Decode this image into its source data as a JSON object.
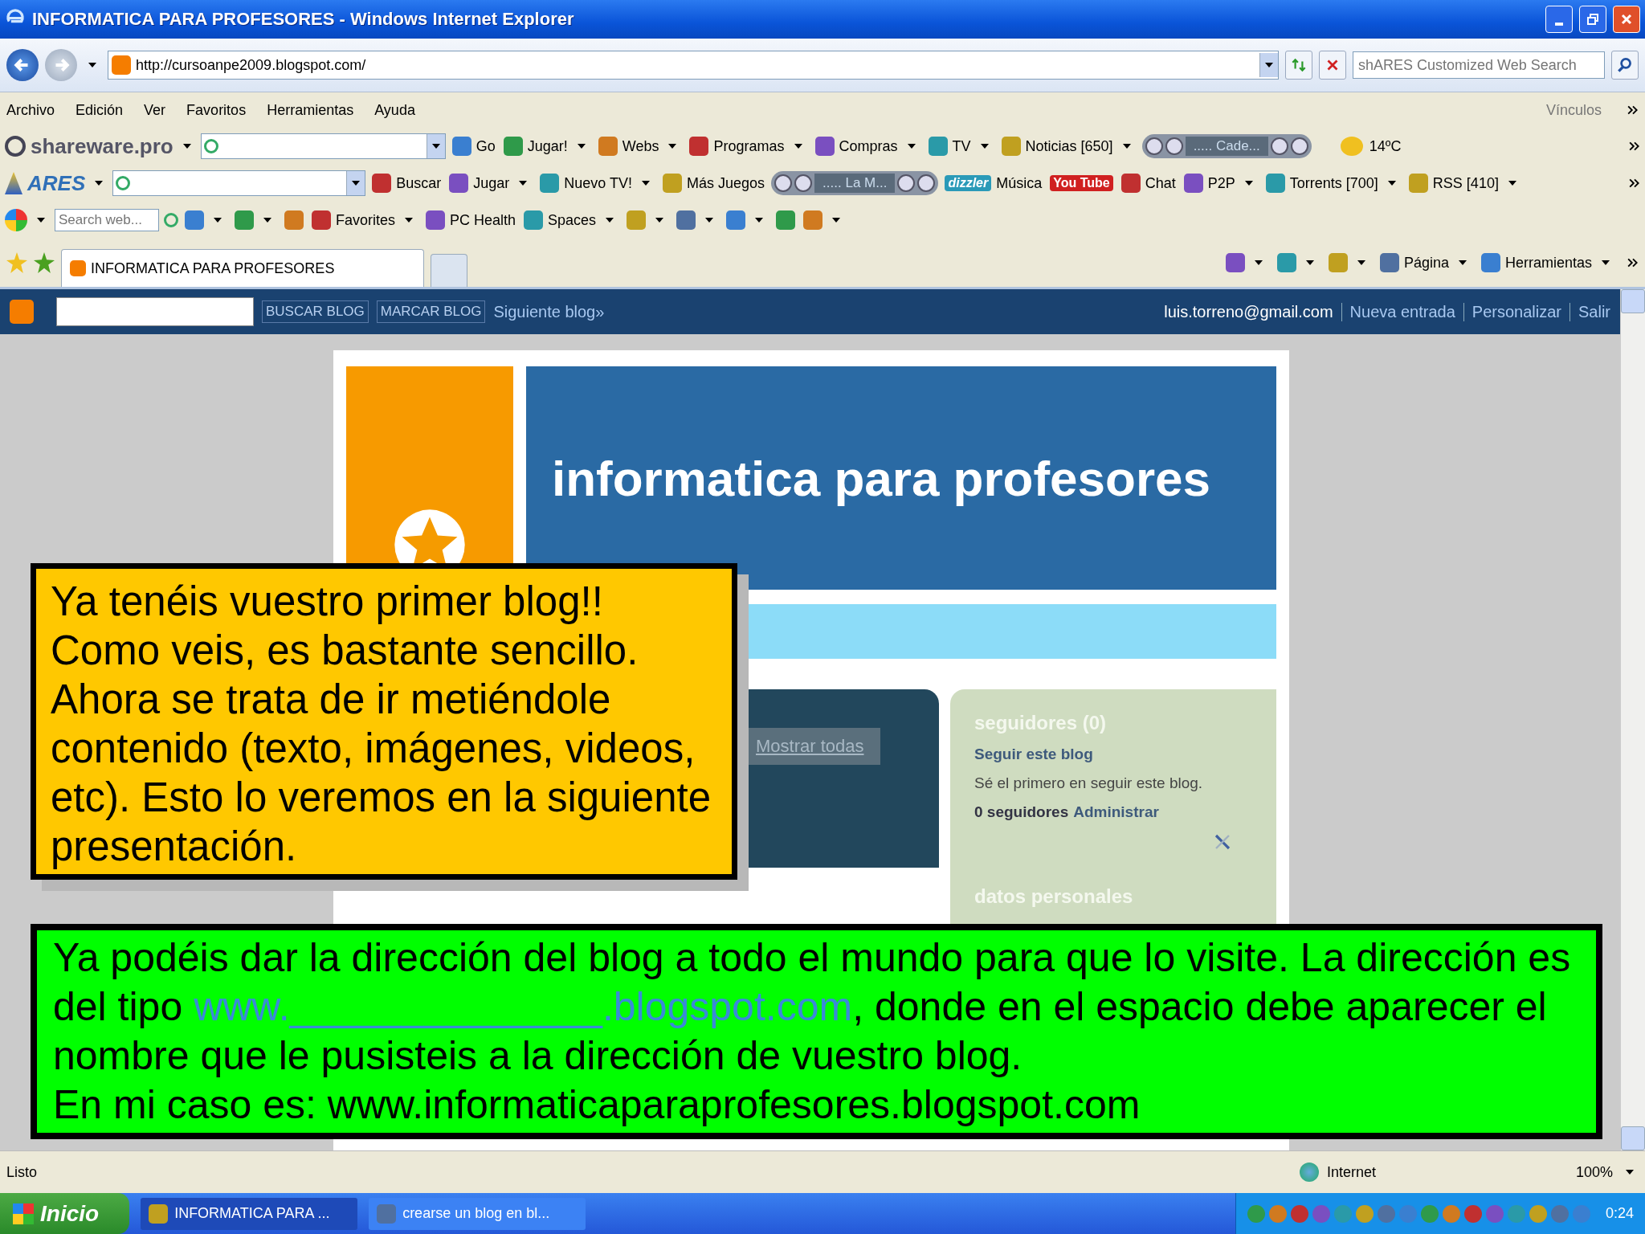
{
  "window": {
    "title": "INFORMATICA PARA PROFESORES - Windows Internet Explorer"
  },
  "address_bar": {
    "url": "http://cursoanpe2009.blogspot.com/",
    "search_placeholder": "shARES Customized Web Search"
  },
  "menu": {
    "items": [
      "Archivo",
      "Edición",
      "Ver",
      "Favoritos",
      "Herramientas",
      "Ayuda"
    ],
    "links_label": "Vínculos"
  },
  "toolbar_shareware": {
    "brand": "shareware.pro",
    "items": [
      {
        "label": "Go",
        "dropdown": false
      },
      {
        "label": "Jugar!",
        "dropdown": true
      },
      {
        "label": "Webs",
        "dropdown": true
      },
      {
        "label": "Programas",
        "dropdown": true
      },
      {
        "label": "Compras",
        "dropdown": true
      },
      {
        "label": "TV",
        "dropdown": true
      },
      {
        "label": "Noticias [650]",
        "dropdown": true
      }
    ],
    "player_text": "..... Cade...",
    "weather": "14ºC"
  },
  "toolbar_ares": {
    "brand": "ARES",
    "items": [
      {
        "label": "Buscar",
        "dropdown": false
      },
      {
        "label": "Jugar",
        "dropdown": true
      },
      {
        "label": "Nuevo TV!",
        "dropdown": true
      },
      {
        "label": "Más Juegos",
        "dropdown": false
      }
    ],
    "player_text": "..... La M...",
    "items_after": [
      {
        "logo": "dizzler",
        "label": "Música",
        "dropdown": false
      },
      {
        "logo": "You Tube",
        "dropdown": false
      },
      {
        "label": "Chat",
        "dropdown": false
      },
      {
        "label": "P2P",
        "dropdown": true
      },
      {
        "label": "Torrents [700]",
        "dropdown": true
      },
      {
        "label": "RSS [410]",
        "dropdown": true
      }
    ]
  },
  "toolbar_live": {
    "search_placeholder": "Search web...",
    "items": [
      {
        "dropdown": true
      },
      {
        "dropdown": true
      },
      {
        "dropdown": false
      },
      {
        "label": "Favorites",
        "dropdown": true
      },
      {
        "label": "PC Health",
        "dropdown": false
      },
      {
        "label": "Spaces",
        "dropdown": true
      },
      {
        "dropdown": true
      },
      {
        "dropdown": true
      },
      {
        "dropdown": true
      },
      {
        "dropdown": false
      },
      {
        "dropdown": true
      }
    ]
  },
  "tab_bar": {
    "tabs": [
      {
        "label": "INFORMATICA PARA PROFESORES",
        "selected": true
      }
    ],
    "commands": [
      {
        "dropdown": true
      },
      {
        "dropdown": true
      },
      {
        "dropdown": true
      },
      {
        "label": "Página",
        "dropdown": true
      },
      {
        "label": "Herramientas",
        "dropdown": true
      }
    ]
  },
  "blogger_bar": {
    "buttons": [
      "BUSCAR BLOG",
      "MARCAR BLOG"
    ],
    "next_link": "Siguiente blog»",
    "user": "luis.torreno@gmail.com",
    "links": [
      "Nueva entrada",
      "Personalizar",
      "Salir"
    ]
  },
  "blog": {
    "title": "informatica para profesores",
    "show_all": "Mostrar todas",
    "followers_widget": {
      "heading": "seguidores (0)",
      "follow_link": "Seguir este blog",
      "note": "Sé el primero en seguir este blog.",
      "count": "0 seguidores",
      "admin_link": "Administrar"
    },
    "profile_heading": "datos personales"
  },
  "callout_yellow": {
    "lines": [
      "Ya tenéis vuestro primer blog!!",
      "Como veis, es bastante sencillo.",
      "Ahora se trata de ir metiéndole contenido (texto, imágenes, videos, etc). Esto lo veremos en la siguiente presentación."
    ]
  },
  "callout_green": {
    "text_before": "Ya podéis dar la dirección del blog a todo el mundo para que lo visite. La dirección es del tipo ",
    "example_address": "www.______________.blogspot.com",
    "text_after": ", donde en el espacio debe aparecer el nombre que le pusisteis a la dirección de vuestro blog.",
    "last_line": "En mi caso es: www.informaticaparaprofesores.blogspot.com"
  },
  "status_bar": {
    "status": "Listo",
    "zone": "Internet",
    "zoom": "100%"
  },
  "taskbar": {
    "start": "Inicio",
    "tasks": [
      {
        "label": "INFORMATICA PARA ...",
        "selected": true
      },
      {
        "label": "crearse un blog en bl...",
        "selected": false
      }
    ],
    "clock": "0:24"
  }
}
